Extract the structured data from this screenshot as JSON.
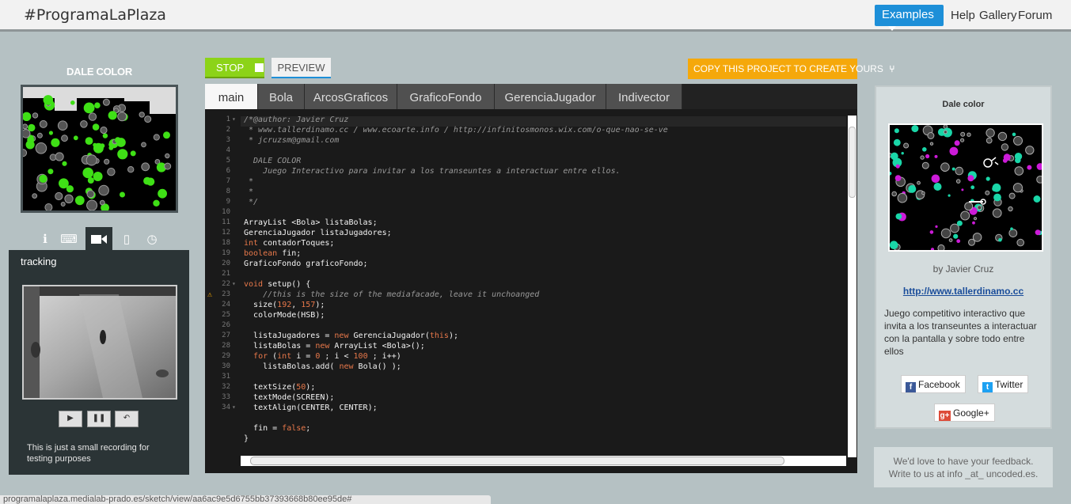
{
  "header": {
    "brand": "#ProgramaLaPlaza",
    "nav": {
      "examples": "Examples",
      "help": "Help",
      "gallery": "Gallery",
      "forum": "Forum"
    }
  },
  "left": {
    "title": "DALE COLOR",
    "tabs": [
      {
        "icon": "info-icon",
        "glyph": "ℹ"
      },
      {
        "icon": "keyboard-icon",
        "glyph": "⌨"
      },
      {
        "icon": "video-camera-icon",
        "glyph": "■"
      },
      {
        "icon": "mobile-icon",
        "glyph": "▯"
      },
      {
        "icon": "clock-icon",
        "glyph": "◷"
      }
    ],
    "tracking": {
      "label": "tracking",
      "play": "▶",
      "pause": "❚❚",
      "rewind": "↶",
      "note": "This is just a small recording for testing purposes"
    }
  },
  "toolbar": {
    "stop_label": "STOP",
    "preview_label": "PREVIEW",
    "copy_label": "COPY THIS PROJECT TO CREATE YOURS",
    "copy_icon": "fork-icon"
  },
  "editor": {
    "tabs": [
      "main",
      "Bola",
      "ArcosGraficos",
      "GraficoFondo",
      "GerenciaJugador",
      "Indivector"
    ],
    "active_tab": "main",
    "lines": [
      {
        "n": "1",
        "fold": "▾",
        "text": "/*@author: Javier Cruz",
        "comment": true
      },
      {
        "n": "2",
        "text": " * www.tallerdinamo.cc / www.ecoarte.info / http://infinitosmonos.wix.com/o-que-nao-se-ve",
        "comment": true
      },
      {
        "n": "3",
        "text": " * jcruzsm@gmail.com",
        "comment": true
      },
      {
        "n": "4",
        "text": "",
        "comment": true
      },
      {
        "n": "5",
        "text": "  DALE COLOR",
        "comment": true
      },
      {
        "n": "6",
        "text": "    Juego Interactivo para invitar a los transeuntes a interactuar entre ellos.",
        "comment": true
      },
      {
        "n": "7",
        "text": " *",
        "comment": true
      },
      {
        "n": "8",
        "text": " *",
        "comment": true
      },
      {
        "n": "9",
        "text": " */",
        "comment": true
      },
      {
        "n": "10",
        "text": ""
      },
      {
        "n": "11",
        "text": "ArrayList <Bola> listaBolas;"
      },
      {
        "n": "12",
        "text": "GerenciaJugador listaJugadores;"
      },
      {
        "n": "18",
        "text": "int contadorToques;"
      },
      {
        "n": "19",
        "text": "boolean fin;"
      },
      {
        "n": "20",
        "text": "GraficoFondo graficoFondo;"
      },
      {
        "n": "21",
        "text": ""
      },
      {
        "n": "22",
        "fold": "▾",
        "text": "void setup() {"
      },
      {
        "n": "23",
        "warn": true,
        "text": "    //this is the size of the mediafacade, leave it unchoanged",
        "comment": true
      },
      {
        "n": "24",
        "text": "  size(192, 157);"
      },
      {
        "n": "25",
        "text": "  colorMode(HSB);"
      },
      {
        "n": "26",
        "text": ""
      },
      {
        "n": "27",
        "text": "  listaJugadores = new GerenciaJugador(this);"
      },
      {
        "n": "28",
        "text": "  listaBolas = new ArrayList <Bola>();"
      },
      {
        "n": "29",
        "text": "  for (int i = 0 ; i < 100 ; i++)"
      },
      {
        "n": "30",
        "text": "    listaBolas.add( new Bola() );"
      },
      {
        "n": "31",
        "text": ""
      },
      {
        "n": "32",
        "text": "  textSize(50);"
      },
      {
        "n": "33",
        "text": "  textMode(SCREEN);"
      },
      {
        "n": "34",
        "fold": "▾",
        "text": "  textAlign(CENTER, CENTER);"
      },
      {
        "n": "",
        "text": ""
      },
      {
        "n": "",
        "text": "  fin = false;"
      },
      {
        "n": "",
        "text": "}"
      }
    ]
  },
  "card": {
    "title": "Dale color",
    "author": "by Javier Cruz",
    "link": "http://www.tallerdinamo.cc",
    "description": "Juego competitivo interactivo que invita a los transeuntes a interactuar con la pantalla y sobre todo entre ellos",
    "share": {
      "facebook": "Facebook",
      "twitter": "Twitter",
      "google": "Google+"
    }
  },
  "feedback": {
    "line1": "We'd love to have your feedback.",
    "line2": "Write to us at info _at_ uncoded.es."
  },
  "status_url": "programalaplaza.medialab-prado.es/sketch/view/aa6ac9e5d6755bb37393668b80ee95de#",
  "colors": {
    "accent": "#1d8fd8",
    "stop": "#8cd318",
    "copy": "#f5a80b",
    "background": "#b5c1c3"
  }
}
